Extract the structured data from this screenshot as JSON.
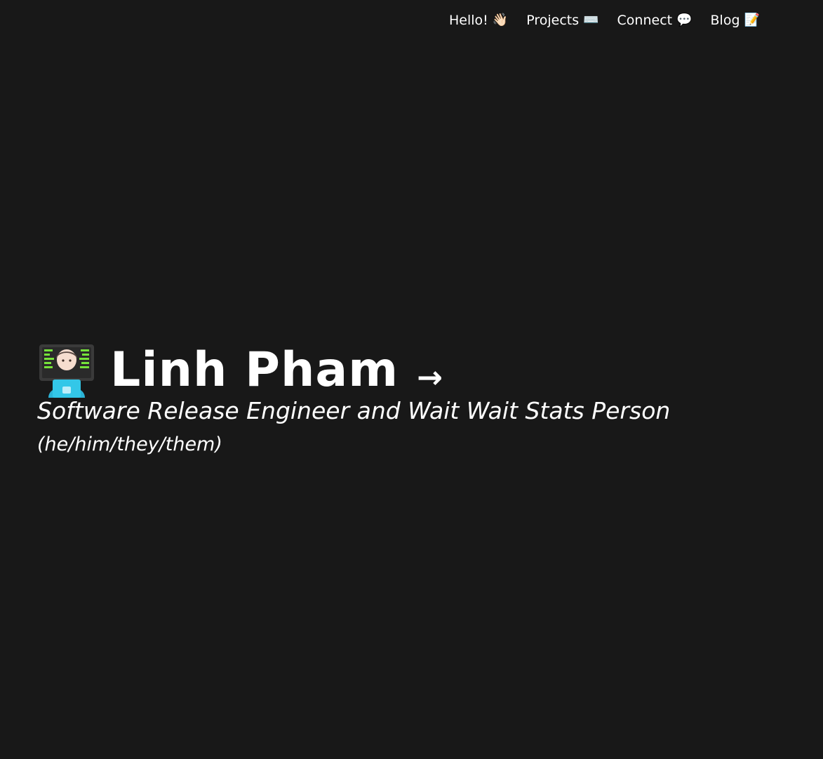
{
  "nav": {
    "items": [
      {
        "label": "Hello!",
        "emoji": "👋🏻"
      },
      {
        "label": "Projects",
        "emoji": "⌨️"
      },
      {
        "label": "Connect",
        "emoji": "💬"
      },
      {
        "label": "Blog",
        "emoji": "📝"
      }
    ]
  },
  "hero": {
    "avatar_icon": "technologist-icon",
    "name": "Linh Pham",
    "arrow": "→",
    "subtitle": "Software Release Engineer and Wait Wait Stats Person",
    "pronouns": "(he/him/they/them)"
  },
  "colors": {
    "background": "#181818",
    "text": "#ffffff"
  }
}
